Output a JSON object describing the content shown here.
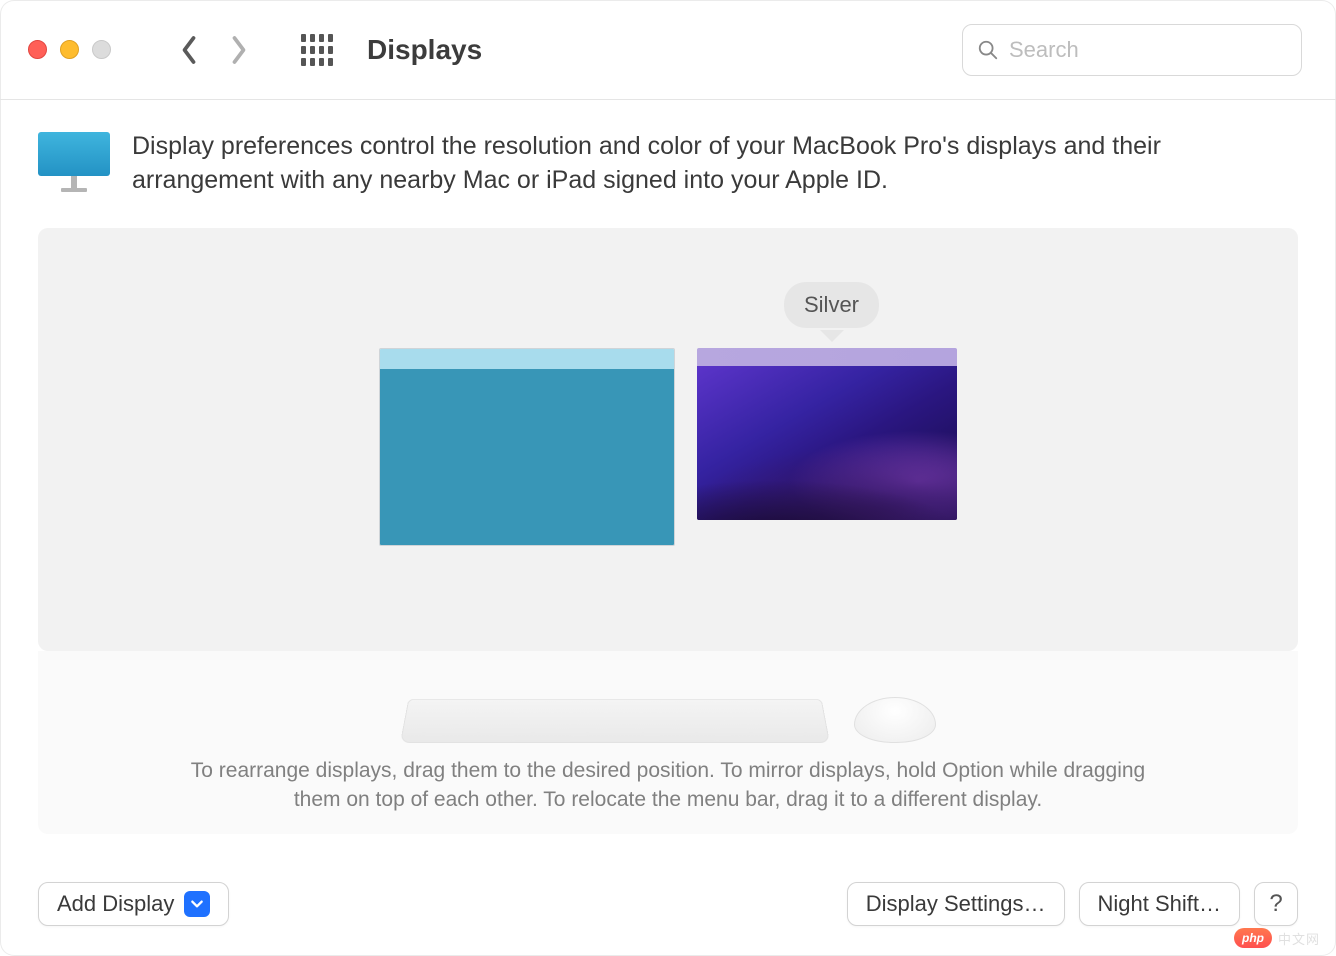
{
  "header": {
    "title": "Displays",
    "search_placeholder": "Search"
  },
  "intro": {
    "text": "Display preferences control the resolution and color of your MacBook Pro's displays and their arrangement with any nearby Mac or iPad signed into your Apple ID."
  },
  "arrangement": {
    "tooltip": "Silver"
  },
  "help_text": "To rearrange displays, drag them to the desired position. To mirror displays, hold Option while dragging them on top of each other. To relocate the menu bar, drag it to a different display.",
  "footer": {
    "add_display": "Add Display",
    "display_settings": "Display Settings…",
    "night_shift": "Night Shift…",
    "help": "?"
  },
  "watermark": {
    "badge": "php",
    "text": "中文网"
  }
}
